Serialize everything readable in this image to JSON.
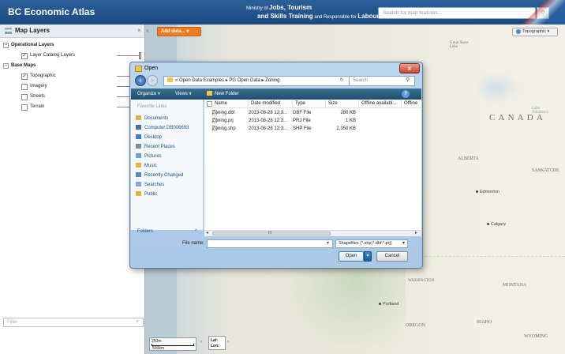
{
  "header": {
    "app_title": "BC Economic Atlas",
    "ministry_line1_prefix": "Ministry of",
    "ministry_line1_bold": "Jobs, Tourism",
    "ministry_line2_bold": "and Skills Training",
    "ministry_line2_suffix": "and Responsible for",
    "ministry_line2_end": "Labour",
    "search_placeholder": "Search for map features..."
  },
  "left_panel": {
    "title": "Map Layers",
    "close": "×",
    "tree": [
      {
        "type": "group",
        "label": "Operational Layers",
        "expander": "−"
      },
      {
        "type": "layer",
        "label": "Layer Catalog Layers",
        "checked": true,
        "slider": true
      },
      {
        "type": "group",
        "label": "Base Maps",
        "expander": "−"
      },
      {
        "type": "layer",
        "label": "Topographic",
        "checked": true,
        "slider": true
      },
      {
        "type": "layer",
        "label": "Imagery",
        "checked": false,
        "slider": true
      },
      {
        "type": "layer",
        "label": "Streets",
        "checked": false,
        "slider": true
      },
      {
        "type": "layer",
        "label": "Terrain",
        "checked": false,
        "slider": true
      }
    ],
    "filter_placeholder": "Filter",
    "filter_clear": "×"
  },
  "map": {
    "add_data": "Add data... ▾",
    "basemap": "Topographic ▾",
    "scale_top": "250m",
    "scale_bottom": "500km",
    "lat_label": "Lat:",
    "lon_label": "Lon:",
    "labels": {
      "canada": "C A N A D A",
      "alberta": "ALBERTA",
      "saskatchewan": "SASKATCHE",
      "montana": "MONTANA",
      "idaho": "IDAHO",
      "oregon": "OREGON",
      "wyoming": "WYOMING",
      "washington": "WASHINGTON",
      "edmonton": "Edmonton",
      "calgary": "Calgary",
      "portland": "Portland",
      "great_slave_lake": "Great Slave Lake",
      "lake_athabasca": "Lake Athabasca"
    }
  },
  "dialog": {
    "title": "Open",
    "close": "x",
    "breadcrumb": "« Open Data Examples ▸ PG Open Data ▸ Zoning",
    "search_placeholder": "Search",
    "toolbar": {
      "organize": "Organize ▾",
      "views": "Views ▾",
      "new_folder": "New Folder",
      "help": "?"
    },
    "nav": {
      "header": "Favorite Links",
      "items": [
        "Documents",
        "Computer DB006693",
        "Desktop",
        "Recent Places",
        "Pictures",
        "Music",
        "Recently Changed",
        "Searches",
        "Public"
      ],
      "folders": "Folders",
      "folders_arrow": "^"
    },
    "columns": [
      "Name",
      "Date modified",
      "Type",
      "Size",
      "Offline availabi...",
      "Offline"
    ],
    "files": [
      {
        "name": "Zoning.dbf",
        "date": "2013-08-28 12:3...",
        "type": "DBF File",
        "size": "280 KB"
      },
      {
        "name": "Zoning.prj",
        "date": "2013-08-28 12:3...",
        "type": "PRJ File",
        "size": "1 KB"
      },
      {
        "name": "Zoning.shp",
        "date": "2013-08-28 12:3...",
        "type": "SHP File",
        "size": "2,350 KB"
      }
    ],
    "scroll_grip": "III",
    "file_name_label": "File name:",
    "file_name_value": "",
    "file_type": "Shapefiles (*.shp;*.dbf;*.prj)",
    "open": "Open",
    "cancel": "Cancel"
  },
  "colors": {
    "header_bg": "#1f4e86",
    "add_data_orange": "#f07c22",
    "dialog_chrome": "#b3cfe9",
    "command_bar": "#2b5f80",
    "close_red": "#c9422d"
  },
  "icons": [
    "layers-icon",
    "search-icon",
    "globe-icon",
    "folder-icon",
    "refresh-icon",
    "help-icon",
    "back-arrow-icon",
    "forward-arrow-icon",
    "file-icon"
  ]
}
